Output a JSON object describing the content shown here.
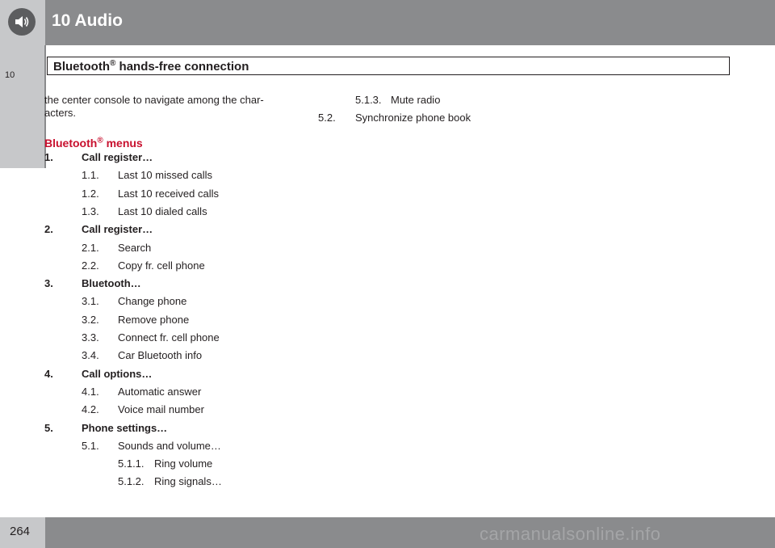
{
  "header": {
    "chapter_title": "10 Audio",
    "section_title": "Bluetooth",
    "section_sup": "®",
    "section_rest": " hands-free connection",
    "side_tab_number": "10",
    "icon": "speaker-icon"
  },
  "body": {
    "intro": "the center console to navigate among the char-acters.",
    "heading": "Bluetooth",
    "heading_sup": "®",
    "heading_rest": " menus",
    "left_column": [
      {
        "num": "1.",
        "text": "Call register…",
        "level": 1
      },
      {
        "num": "1.1.",
        "text": "Last 10 missed calls",
        "level": 2
      },
      {
        "num": "1.2.",
        "text": "Last 10 received calls",
        "level": 2
      },
      {
        "num": "1.3.",
        "text": "Last 10 dialed calls",
        "level": 2
      },
      {
        "num": "2.",
        "text": "Call register…",
        "level": 1
      },
      {
        "num": "2.1.",
        "text": "Search",
        "level": 2
      },
      {
        "num": "2.2.",
        "text": "Copy fr. cell phone",
        "level": 2
      },
      {
        "num": "3.",
        "text": "Bluetooth…",
        "level": 1
      },
      {
        "num": "3.1.",
        "text": "Change phone",
        "level": 2
      },
      {
        "num": "3.2.",
        "text": "Remove phone",
        "level": 2
      },
      {
        "num": "3.3.",
        "text": "Connect fr. cell phone",
        "level": 2
      },
      {
        "num": "3.4.",
        "text": "Car Bluetooth info",
        "level": 2
      },
      {
        "num": "4.",
        "text": "Call options…",
        "level": 1
      },
      {
        "num": "4.1.",
        "text": "Automatic answer",
        "level": 2
      },
      {
        "num": "4.2.",
        "text": "Voice mail number",
        "level": 2
      },
      {
        "num": "5.",
        "text": "Phone settings…",
        "level": 1
      },
      {
        "num": "5.1.",
        "text": "Sounds and volume…",
        "level": 2
      },
      {
        "num": "5.1.1.",
        "text": "Ring volume",
        "level": 3
      },
      {
        "num": "5.1.2.",
        "text": "Ring signals…",
        "level": 3
      }
    ],
    "right_column": [
      {
        "num": "5.1.3.",
        "text": "Mute radio",
        "level": 3
      },
      {
        "num": "5.2.",
        "text": "Synchronize phone book",
        "level": 2
      }
    ]
  },
  "footer": {
    "page_number": "264",
    "watermark": "carmanualsonline.info"
  }
}
